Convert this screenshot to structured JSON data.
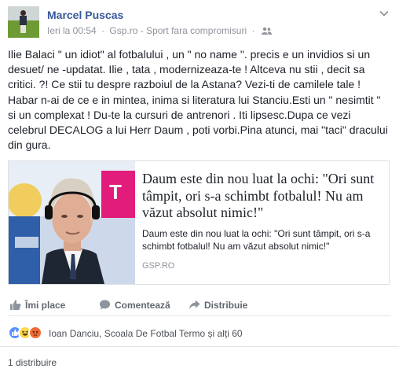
{
  "post": {
    "author": "Marcel Puscas",
    "timestamp": "Ieri la 00:54",
    "source": "Gsp.ro - Sport fara compromisuri",
    "audience_icon": "friends-icon",
    "text": "Ilie Balaci \" un idiot\" al fotbalului , un \" no name \". precis e un invidios si un desuet/ ne -updatat. Ilie , tata , modernizeaza-te ! Altceva nu stii , decit sa critici. ?! Ce stii tu despre razboiul de la Astana? Vezi-ti de camilele tale ! Habar n-ai de ce e in mintea, inima si literatura lui Stanciu.Esti un \" nesimtit \" si un complexat ! Du-te la cursuri de antrenori . Iti lipsesc.Dupa ce vezi celebrul DECALOG a lui Herr Daum , poti vorbi.Pina atunci, mai \"taci\" dracului din gura."
  },
  "link": {
    "title": "Daum este din nou luat la ochi: \"Ori sunt tâmpit, ori s-a schimbt fotbalul! Nu am văzut absolut nimic!\"",
    "description": "Daum este din nou luat la ochi: \"Ori sunt tâmpit, ori s-a schimbt fotbalul! Nu am văzut absolut nimic!\"",
    "domain": "GSP.RO"
  },
  "actions": {
    "like": "Îmi place",
    "comment": "Comentează",
    "share": "Distribuie"
  },
  "reactions": {
    "names": "Ioan Danciu, Scoala De Fotbal Termo și alți 60",
    "types": [
      "like",
      "haha",
      "angry"
    ]
  },
  "shares": "1 distribuire",
  "colors": {
    "author": "#365899",
    "meta": "#90949c",
    "text": "#1d2129",
    "like": "#5890ff",
    "haha": "#ffd850",
    "angry": "#f06b35"
  }
}
